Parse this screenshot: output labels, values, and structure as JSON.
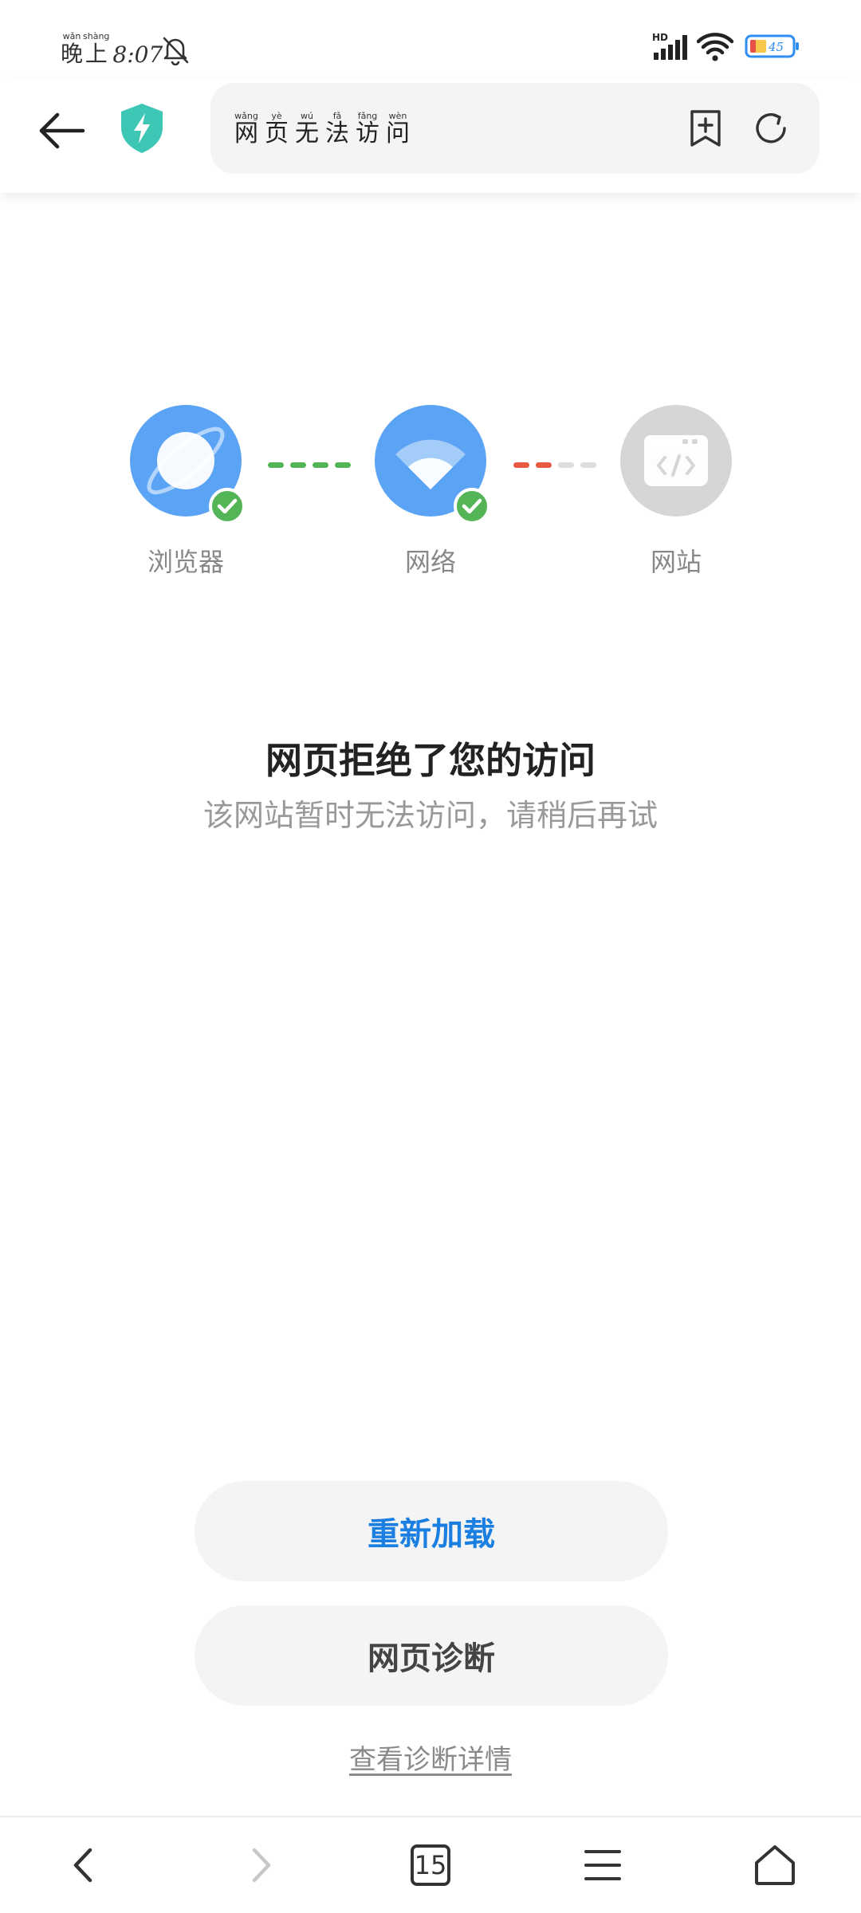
{
  "status_bar": {
    "period": {
      "chars": [
        "晚",
        "上"
      ],
      "pinyin": [
        "wǎn",
        "shàng"
      ]
    },
    "clock": "8:07",
    "network_badge": "HD",
    "battery_level": "45",
    "icons": [
      "bell-off-icon",
      "signal-icon",
      "wifi-icon",
      "battery-icon"
    ]
  },
  "toolbar": {
    "page_title_chars": [
      "网",
      "页",
      "无",
      "法",
      "访",
      "问"
    ],
    "page_title_pinyin": [
      "wǎng",
      "yè",
      "wú",
      "fǎ",
      "fǎng",
      "wèn"
    ],
    "icons": [
      "back-arrow-icon",
      "shield-bolt-icon",
      "add-bookmark-icon",
      "refresh-icon"
    ],
    "shield_color": "#3fc7b6"
  },
  "diagnosis": {
    "nodes": [
      {
        "label": "浏览器",
        "status": "ok",
        "icon": "planet-icon"
      },
      {
        "label": "网络",
        "status": "ok",
        "icon": "wifi-icon"
      },
      {
        "label": "网站",
        "status": "unreachable",
        "icon": "code-window-icon"
      }
    ],
    "colors": {
      "ok": "#54b556",
      "error": "#e85a42",
      "node_active": "#5aa3f5",
      "node_inactive": "#d6d6d6",
      "inactive_link": "#dedede"
    }
  },
  "message": {
    "title": "网页拒绝了您的访问",
    "subtitle": "该网站暂时无法访问，请稍后再试"
  },
  "actions": {
    "reload_label": "重新加载",
    "diagnose_label": "网页诊断",
    "details_link": "查看诊断详情",
    "accent_color": "#1a7fe0"
  },
  "bottom_nav": {
    "tab_count": "15",
    "icons": [
      "nav-back-icon",
      "nav-forward-icon",
      "tabs-icon",
      "menu-icon",
      "home-icon"
    ]
  }
}
